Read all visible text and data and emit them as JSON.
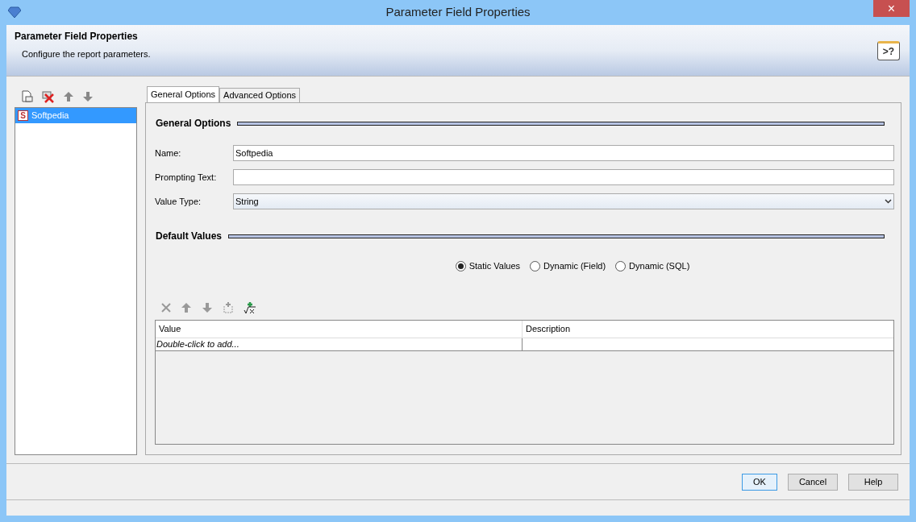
{
  "window": {
    "title": "Parameter Field Properties",
    "close": "×"
  },
  "header": {
    "title": "Parameter Field Properties",
    "subtitle": "Configure the report parameters.",
    "help_label": ">?"
  },
  "parameters": [
    {
      "label": "Softpedia",
      "badge": "S",
      "selected": true
    }
  ],
  "tabs": [
    {
      "label": "General Options",
      "selected": true
    },
    {
      "label": "Advanced Options",
      "selected": false
    }
  ],
  "general_section": "General Options",
  "fields": [
    {
      "kind": "text",
      "label": "Name:",
      "value": "Softpedia"
    },
    {
      "kind": "text",
      "label": "Prompting Text:"
    },
    {
      "kind": "select",
      "label": "Value Type:",
      "value": "String"
    }
  ],
  "default_section": "Default Values",
  "radios": [
    {
      "label": "Static Values",
      "selected": true
    },
    {
      "label": "Dynamic (Field)",
      "selected": false
    },
    {
      "label": "Dynamic (SQL)",
      "selected": false
    }
  ],
  "table": {
    "columns": [
      "Value",
      "Description"
    ],
    "placeholder_row": "Double-click to add..."
  },
  "buttons": [
    {
      "label": "OK",
      "default": true
    },
    {
      "label": "Cancel",
      "default": false
    },
    {
      "label": "Help",
      "default": false
    }
  ]
}
